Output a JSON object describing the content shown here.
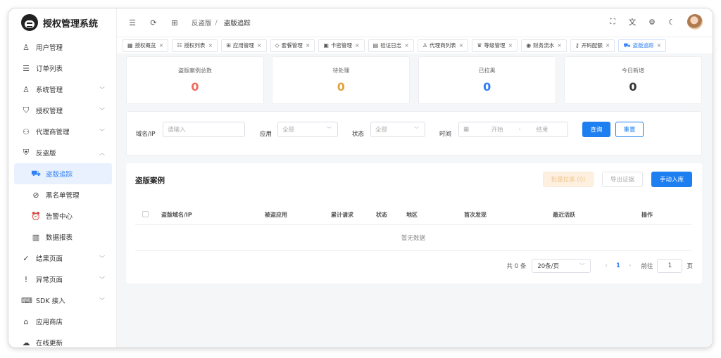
{
  "app": {
    "title": "授权管理系统"
  },
  "sidebar": {
    "items": [
      {
        "label": "用户管理",
        "icon": "user-icon",
        "glyph": "♙",
        "arrow": false
      },
      {
        "label": "订单列表",
        "icon": "order-list-icon",
        "glyph": "☰",
        "arrow": false
      },
      {
        "label": "系统管理",
        "icon": "user-settings-icon",
        "glyph": "♙",
        "arrow": true
      },
      {
        "label": "授权管理",
        "icon": "shield-icon",
        "glyph": "⛉",
        "arrow": true
      },
      {
        "label": "代理商管理",
        "icon": "org-icon",
        "glyph": "⚇",
        "arrow": true
      },
      {
        "label": "反盗版",
        "icon": "shield-plus-icon",
        "glyph": "⛨",
        "arrow": true,
        "expanded": true
      }
    ],
    "sub_items": [
      {
        "label": "盗版追踪",
        "icon": "car-icon",
        "glyph": "⛟",
        "active": true
      },
      {
        "label": "黑名单管理",
        "icon": "ban-icon",
        "glyph": "⊘"
      },
      {
        "label": "告警中心",
        "icon": "alarm-icon",
        "glyph": "⏰"
      },
      {
        "label": "数据报表",
        "icon": "chart-icon",
        "glyph": "▥"
      }
    ],
    "bottom_items": [
      {
        "label": "结果页面",
        "icon": "check-circle-icon",
        "glyph": "✓",
        "arrow": true
      },
      {
        "label": "异常页面",
        "icon": "alert-circle-icon",
        "glyph": "!",
        "arrow": true
      },
      {
        "label": "SDK 接入",
        "icon": "code-icon",
        "glyph": "⌨",
        "arrow": true
      },
      {
        "label": "应用商店",
        "icon": "store-icon",
        "glyph": "⌂",
        "arrow": false
      },
      {
        "label": "在线更新",
        "icon": "cloud-upload-icon",
        "glyph": "☁",
        "arrow": false
      }
    ]
  },
  "topbar": {
    "breadcrumb": [
      "反盗版",
      "盗版追踪"
    ]
  },
  "tabs": [
    {
      "label": "授权概览",
      "glyph": "▦"
    },
    {
      "label": "授权列表",
      "glyph": "☷"
    },
    {
      "label": "应用管理",
      "glyph": "⊞"
    },
    {
      "label": "套餐管理",
      "glyph": "◇"
    },
    {
      "label": "卡密管理",
      "glyph": "▣"
    },
    {
      "label": "验证日志",
      "glyph": "▤"
    },
    {
      "label": "代理商列表",
      "glyph": "♙"
    },
    {
      "label": "等级管理",
      "glyph": "♛"
    },
    {
      "label": "财务流水",
      "glyph": "◉"
    },
    {
      "label": "开码配额",
      "glyph": "⚷"
    },
    {
      "label": "盗版追踪",
      "glyph": "⛟",
      "active": true
    }
  ],
  "stats": [
    {
      "label": "盗版案例总数",
      "value": "0",
      "color": "#f06a5d"
    },
    {
      "label": "待处理",
      "value": "0",
      "color": "#e6a23c"
    },
    {
      "label": "已拉黑",
      "value": "0",
      "color": "#2f7ef5"
    },
    {
      "label": "今日新增",
      "value": "0",
      "color": "#333333"
    }
  ],
  "filter": {
    "domain_label": "域名/IP",
    "domain_placeholder": "请输入",
    "app_label": "应用",
    "app_value": "全部",
    "status_label": "状态",
    "status_value": "全部",
    "time_label": "时间",
    "time_start": "开始",
    "time_sep": "-",
    "time_end": "结束",
    "query_label": "查询",
    "reset_label": "重置"
  },
  "table": {
    "title": "盗版案例",
    "batch_block_label": "批量拉黑 (0)",
    "export_label": "导出证据",
    "manual_add_label": "手动入库",
    "columns": [
      "盗版域名/IP",
      "被盗应用",
      "累计请求",
      "状态",
      "地区",
      "首次发现",
      "最近活跃",
      "操作"
    ],
    "empty_text": "暂无数据"
  },
  "pager": {
    "total": "共 0 条",
    "page_size": "20条/页",
    "current_page": "1",
    "goto_label": "前往",
    "goto_value": "1",
    "page_unit": "页"
  }
}
